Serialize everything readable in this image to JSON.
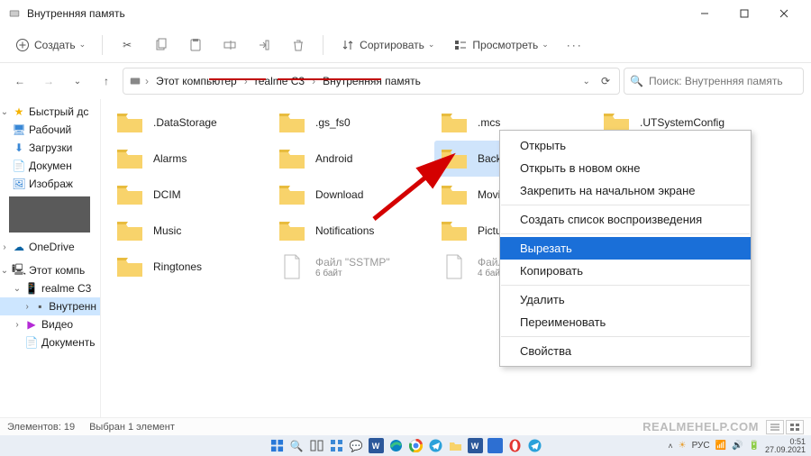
{
  "window": {
    "title": "Внутренняя память"
  },
  "toolbar": {
    "new": "Создать",
    "sort": "Сортировать",
    "view": "Просмотреть"
  },
  "breadcrumbs": {
    "seg0": "Этот компьютер",
    "seg1": "realme C3",
    "seg2": "Внутренняя память"
  },
  "search": {
    "placeholder": "Поиск: Внутренняя память"
  },
  "sidebar": {
    "quick": "Быстрый дс",
    "desktop": "Рабочий",
    "downloads": "Загрузки",
    "documents": "Докумен",
    "pictures": "Изображ",
    "onedrive": "OneDrive",
    "thispc": "Этот компь",
    "realme": "realme C3",
    "internal": "Внутренн",
    "video": "Видео",
    "docs2": "Документь"
  },
  "folders": {
    "r0c0": ".DataStorage",
    "r0c1": ".gs_fs0",
    "r0c2": ".mcs",
    "r0c3": ".UTSystemConfig",
    "r1c0": "Alarms",
    "r1c1": "Android",
    "r1c2": "Backu",
    "r1c3": "",
    "r2c0": "DCIM",
    "r2c1": "Download",
    "r2c2": "Movie",
    "r2c3": "",
    "r3c0": "Music",
    "r3c1": "Notifications",
    "r3c2": "Pictur",
    "r3c3": "",
    "r4c0": "Ringtones",
    "f1": "Файл \"SSTMP\"",
    "f1s": "6 байт",
    "f2": "Файл",
    "f2s": "4 бай"
  },
  "context_menu": {
    "open": "Открыть",
    "open_new": "Открыть в новом окне",
    "pin": "Закрепить на начальном экране",
    "playlist": "Создать список воспроизведения",
    "cut": "Вырезать",
    "copy": "Копировать",
    "delete": "Удалить",
    "rename": "Переименовать",
    "properties": "Свойства"
  },
  "status": {
    "count_label": "Элементов:",
    "count": "19",
    "sel_label": "Выбран 1 элемент",
    "watermark": "REALMEHELP.COM"
  },
  "tray": {
    "lang": "РУС",
    "time": "0:51",
    "date": "27.09.2021"
  }
}
